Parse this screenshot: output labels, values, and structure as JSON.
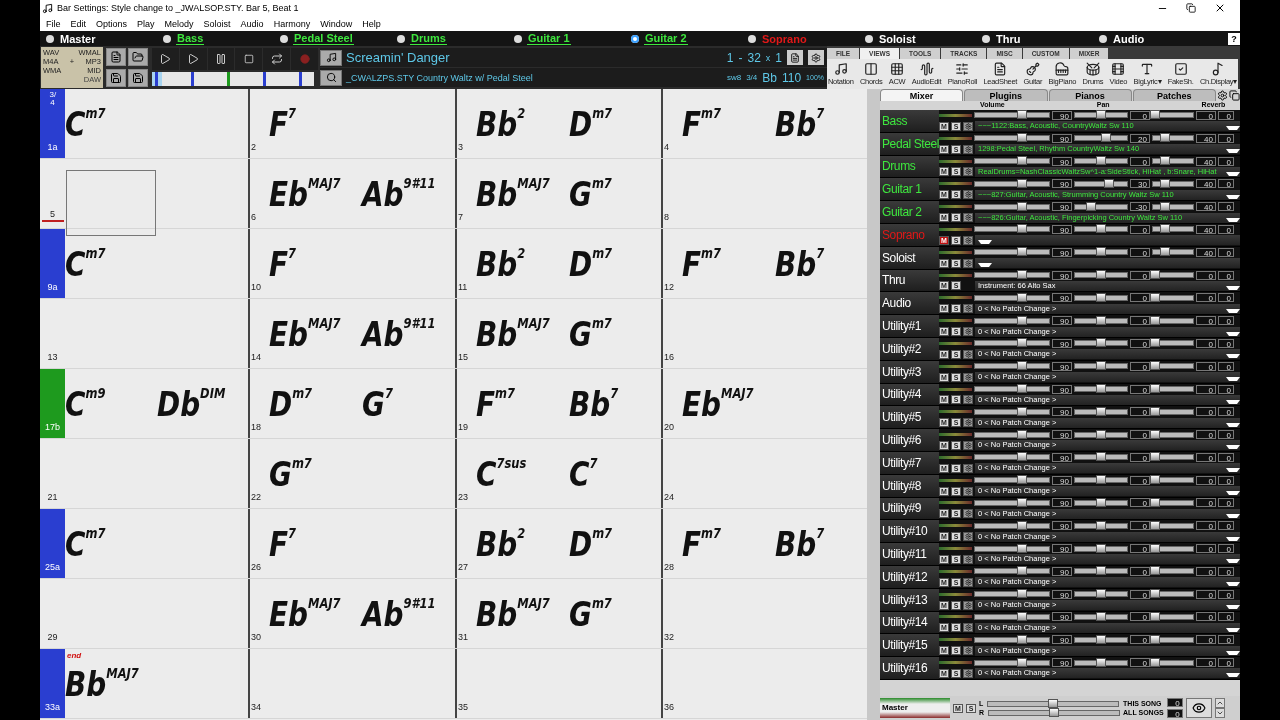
{
  "window": {
    "title": "Bar Settings: Style change to _JWALSOP.STY.  Bar 5, Beat 1"
  },
  "menu": [
    "File",
    "Edit",
    "Options",
    "Play",
    "Melody",
    "Soloist",
    "Audio",
    "Harmony",
    "Window",
    "Help"
  ],
  "tracks": [
    {
      "name": "Master",
      "color": "#ffffff",
      "underlined": false,
      "selected": false
    },
    {
      "name": "Bass",
      "color": "#3ee83e",
      "underlined": true,
      "selected": false
    },
    {
      "name": "Pedal Steel",
      "color": "#3ee83e",
      "underlined": true,
      "selected": false
    },
    {
      "name": "Drums",
      "color": "#3ee83e",
      "underlined": true,
      "selected": false
    },
    {
      "name": "Guitar 1",
      "color": "#3ee83e",
      "underlined": true,
      "selected": false
    },
    {
      "name": "Guitar 2",
      "color": "#3ee83e",
      "underlined": true,
      "selected": true
    },
    {
      "name": "Soprano",
      "color": "#e01818",
      "underlined": false,
      "selected": false
    },
    {
      "name": "Soloist",
      "color": "#ffffff",
      "underlined": false,
      "selected": false
    },
    {
      "name": "Thru",
      "color": "#ffffff",
      "underlined": false,
      "selected": false
    },
    {
      "name": "Audio",
      "color": "#ffffff",
      "underlined": false,
      "selected": false
    }
  ],
  "help_button": "?",
  "file_formats": [
    "WAV",
    "WMAL",
    "M4A",
    "+",
    "MP3",
    "WMA",
    "MID"
  ],
  "daw_label": "DAW",
  "song": {
    "title": "Screamin' Danger",
    "style": "_CWALZPS.STY Country Waltz w/ Pedal Steel"
  },
  "counter": {
    "start": "1",
    "dash": "-",
    "end": "32",
    "times_sign": "x",
    "repeats": "1"
  },
  "song_settings": {
    "feel": "sw8",
    "time_signature": "3/4",
    "key": "Bb",
    "tempo": "110",
    "tempo_percent": "100%"
  },
  "ribbon_tabs": [
    {
      "label": "FILE",
      "selected": false
    },
    {
      "label": "VIEWS",
      "selected": true
    },
    {
      "label": "TOOLS",
      "selected": false
    },
    {
      "label": "TRACKS",
      "selected": false
    },
    {
      "label": "MISC",
      "selected": false
    },
    {
      "label": "CUSTOM",
      "selected": false
    },
    {
      "label": "MIXER",
      "selected": false
    }
  ],
  "ribbon_buttons": [
    "Notation",
    "Chords",
    "ACW",
    "AudioEdit",
    "PianoRoll",
    "LeadSheet",
    "Guitar",
    "BigPiano",
    "Drums",
    "Video",
    "BigLyric▾",
    "FakeSh.",
    "Ch.Display▾"
  ],
  "progress": {
    "level": 0.06
  },
  "chord_rows": [
    {
      "marker": {
        "label": "1a",
        "color": "#2a3ed0"
      },
      "time_signature": "3/4",
      "bars": [
        {
          "chords": [
            {
              "root": "C",
              "ext": "m7"
            }
          ]
        },
        {
          "number": "2",
          "chords": [
            {
              "root": "F",
              "ext": "7"
            }
          ]
        },
        {
          "number": "3",
          "chords": [
            {
              "root": "Bb",
              "ext": "2"
            },
            {
              "root": "D",
              "ext": "m7"
            }
          ]
        },
        {
          "number": "4",
          "chords": [
            {
              "root": "F",
              "ext": "m7"
            },
            {
              "root": "Bb",
              "ext": "7"
            }
          ]
        }
      ]
    },
    {
      "bars": [
        {
          "number": "5",
          "selected": true
        },
        {
          "number": "6",
          "chords": [
            {
              "root": "Eb",
              "ext": "MAJ7"
            },
            {
              "root": "Ab",
              "ext": "9#11"
            }
          ]
        },
        {
          "number": "7",
          "chords": [
            {
              "root": "Bb",
              "ext": "MAJ7"
            },
            {
              "root": "G",
              "ext": "m7"
            }
          ]
        },
        {
          "number": "8"
        }
      ]
    },
    {
      "marker": {
        "label": "9a",
        "color": "#2a3ed0"
      },
      "bars": [
        {
          "chords": [
            {
              "root": "C",
              "ext": "m7"
            }
          ]
        },
        {
          "number": "10",
          "chords": [
            {
              "root": "F",
              "ext": "7"
            }
          ]
        },
        {
          "number": "11",
          "chords": [
            {
              "root": "Bb",
              "ext": "2"
            },
            {
              "root": "D",
              "ext": "m7"
            }
          ]
        },
        {
          "number": "12",
          "chords": [
            {
              "root": "F",
              "ext": "m7"
            },
            {
              "root": "Bb",
              "ext": "7"
            }
          ]
        }
      ]
    },
    {
      "bars": [
        {
          "number": "13"
        },
        {
          "number": "14",
          "chords": [
            {
              "root": "Eb",
              "ext": "MAJ7"
            },
            {
              "root": "Ab",
              "ext": "9#11"
            }
          ]
        },
        {
          "number": "15",
          "chords": [
            {
              "root": "Bb",
              "ext": "MAJ7"
            },
            {
              "root": "G",
              "ext": "m7"
            }
          ]
        },
        {
          "number": "16"
        }
      ]
    },
    {
      "marker": {
        "label": "17b",
        "color": "#1e9a1e"
      },
      "bars": [
        {
          "chords": [
            {
              "root": "C",
              "ext": "m9"
            },
            {
              "root": "Db",
              "ext": "DIM"
            }
          ]
        },
        {
          "number": "18",
          "chords": [
            {
              "root": "D",
              "ext": "m7"
            },
            {
              "root": "G",
              "ext": "7"
            }
          ]
        },
        {
          "number": "19",
          "chords": [
            {
              "root": "F",
              "ext": "m7"
            },
            {
              "root": "Bb",
              "ext": "7"
            }
          ]
        },
        {
          "number": "20",
          "chords": [
            {
              "root": "Eb",
              "ext": "MAJ7"
            }
          ]
        }
      ]
    },
    {
      "bars": [
        {
          "number": "21"
        },
        {
          "number": "22",
          "chords": [
            {
              "root": "G",
              "ext": "m7"
            }
          ]
        },
        {
          "number": "23",
          "chords": [
            {
              "root": "C",
              "ext": "7sus"
            },
            {
              "root": "C",
              "ext": "7"
            }
          ]
        },
        {
          "number": "24"
        }
      ]
    },
    {
      "marker": {
        "label": "25a",
        "color": "#2a3ed0"
      },
      "bars": [
        {
          "chords": [
            {
              "root": "C",
              "ext": "m7"
            }
          ]
        },
        {
          "number": "26",
          "chords": [
            {
              "root": "F",
              "ext": "7"
            }
          ]
        },
        {
          "number": "27",
          "chords": [
            {
              "root": "Bb",
              "ext": "2"
            },
            {
              "root": "D",
              "ext": "m7"
            }
          ]
        },
        {
          "number": "28",
          "chords": [
            {
              "root": "F",
              "ext": "m7"
            },
            {
              "root": "Bb",
              "ext": "7"
            }
          ]
        }
      ]
    },
    {
      "bars": [
        {
          "number": "29"
        },
        {
          "number": "30",
          "chords": [
            {
              "root": "Eb",
              "ext": "MAJ7"
            },
            {
              "root": "Ab",
              "ext": "9#11"
            }
          ]
        },
        {
          "number": "31",
          "chords": [
            {
              "root": "Bb",
              "ext": "MAJ7"
            },
            {
              "root": "G",
              "ext": "m7"
            }
          ]
        },
        {
          "number": "32"
        }
      ]
    },
    {
      "marker": {
        "label": "33a",
        "color": "#2a3ed0"
      },
      "bars": [
        {
          "end_mark": "end",
          "chords": [
            {
              "root": "Bb",
              "ext": "MAJ7"
            }
          ]
        },
        {
          "number": "34"
        },
        {
          "number": "35"
        },
        {
          "number": "36"
        }
      ]
    }
  ],
  "mixer": {
    "tabs": [
      {
        "label": "Mixer",
        "selected": true
      },
      {
        "label": "Plugins",
        "selected": false
      },
      {
        "label": "Pianos",
        "selected": false
      },
      {
        "label": "Patches",
        "selected": false
      }
    ],
    "headers": [
      "Volume",
      "Pan",
      "Reverb"
    ],
    "channels": [
      {
        "name": "Bass",
        "color": "#3ee83e",
        "mute_label": "M",
        "solo_label": "S",
        "muted": false,
        "fx": true,
        "volume": {
          "reading": "90",
          "level": 0.63
        },
        "pan": {
          "reading": "0",
          "level": 0.5
        },
        "reverb": {
          "reading": "0",
          "level": 0.05
        },
        "column_4": "0",
        "patch": "~~~1122:Bass, Acoustic, CountryWaltz Sw 110"
      },
      {
        "name": "Pedal Steel",
        "color": "#3ee83e",
        "mute_label": "M",
        "solo_label": "S",
        "muted": false,
        "fx": true,
        "volume": {
          "reading": "90",
          "level": 0.63
        },
        "pan": {
          "reading": "20",
          "level": 0.6
        },
        "reverb": {
          "reading": "40",
          "level": 0.3
        },
        "column_4": "0",
        "patch": "1298:Pedal Steel, Rhythm CountryWaltz Sw 140"
      },
      {
        "name": "Drums",
        "color": "#3ee83e",
        "mute_label": "M",
        "solo_label": "S",
        "muted": false,
        "fx": true,
        "volume": {
          "reading": "90",
          "level": 0.63
        },
        "pan": {
          "reading": "0",
          "level": 0.5
        },
        "reverb": {
          "reading": "40",
          "level": 0.3
        },
        "column_4": "0",
        "patch": "RealDrums=NashClassicWaltzSw^1-a:SideStick, HiHat , b:Snare, HiHat"
      },
      {
        "name": "Guitar 1",
        "color": "#3ee83e",
        "mute_label": "M",
        "solo_label": "S",
        "muted": false,
        "fx": true,
        "volume": {
          "reading": "90",
          "level": 0.63
        },
        "pan": {
          "reading": "30",
          "level": 0.66
        },
        "reverb": {
          "reading": "40",
          "level": 0.3
        },
        "column_4": "0",
        "patch": "~~~827:Guitar, Acoustic, Strumming Country Waltz Sw 110"
      },
      {
        "name": "Guitar 2",
        "color": "#3ee83e",
        "mute_label": "M",
        "solo_label": "S",
        "muted": false,
        "fx": true,
        "volume": {
          "reading": "90",
          "level": 0.63
        },
        "pan": {
          "reading": "-30",
          "level": 0.3
        },
        "reverb": {
          "reading": "40",
          "level": 0.3
        },
        "column_4": "0",
        "patch": "~~~826:Guitar, Acoustic, Fingerpicking Country Waltz Sw 110"
      },
      {
        "name": "Soprano",
        "color": "#e01818",
        "mute_label": "M",
        "solo_label": "S",
        "muted": true,
        "fx": true,
        "volume": {
          "reading": "90",
          "level": 0.63
        },
        "pan": {
          "reading": "0",
          "level": 0.5
        },
        "reverb": {
          "reading": "40",
          "level": 0.3
        },
        "column_4": "0"
      },
      {
        "name": "Soloist",
        "color": "#ffffff",
        "mute_label": "M",
        "solo_label": "S",
        "muted": false,
        "fx": true,
        "volume": {
          "reading": "90",
          "level": 0.63
        },
        "pan": {
          "reading": "0",
          "level": 0.5
        },
        "reverb": {
          "reading": "40",
          "level": 0.3
        },
        "column_4": "0"
      },
      {
        "name": "Thru",
        "color": "#ffffff",
        "mute_label": "M",
        "solo_label": "S",
        "muted": false,
        "fx": false,
        "volume": {
          "reading": "90",
          "level": 0.63
        },
        "pan": {
          "reading": "0",
          "level": 0.5
        },
        "reverb": {
          "reading": "0",
          "level": 0.05
        },
        "column_4": "0",
        "patch": "Instrument: 66 Alto Sax"
      },
      {
        "name": "Audio",
        "color": "#ffffff",
        "mute_label": "M",
        "solo_label": "S",
        "muted": false,
        "fx": true,
        "volume": {
          "reading": "90",
          "level": 0.63
        },
        "pan": {
          "reading": "0",
          "level": 0.5
        },
        "reverb": {
          "reading": "0",
          "level": 0.05
        },
        "column_4": "0",
        "patch": "0 < No Patch Change >"
      },
      {
        "name": "Utility#1",
        "color": "#ffffff",
        "mute_label": "M",
        "solo_label": "S",
        "muted": false,
        "fx": true,
        "volume": {
          "reading": "90",
          "level": 0.63
        },
        "pan": {
          "reading": "0",
          "level": 0.5
        },
        "reverb": {
          "reading": "0",
          "level": 0.05
        },
        "column_4": "0",
        "patch": "0 < No Patch Change >"
      },
      {
        "name": "Utility#2",
        "color": "#ffffff",
        "mute_label": "M",
        "solo_label": "S",
        "muted": false,
        "fx": true,
        "volume": {
          "reading": "90",
          "level": 0.63
        },
        "pan": {
          "reading": "0",
          "level": 0.5
        },
        "reverb": {
          "reading": "0",
          "level": 0.05
        },
        "column_4": "0",
        "patch": "0 < No Patch Change >"
      },
      {
        "name": "Utility#3",
        "color": "#ffffff",
        "mute_label": "M",
        "solo_label": "S",
        "muted": false,
        "fx": true,
        "volume": {
          "reading": "90",
          "level": 0.63
        },
        "pan": {
          "reading": "0",
          "level": 0.5
        },
        "reverb": {
          "reading": "0",
          "level": 0.05
        },
        "column_4": "0",
        "patch": "0 < No Patch Change >"
      },
      {
        "name": "Utility#4",
        "color": "#ffffff",
        "mute_label": "M",
        "solo_label": "S",
        "muted": false,
        "fx": true,
        "volume": {
          "reading": "90",
          "level": 0.63
        },
        "pan": {
          "reading": "0",
          "level": 0.5
        },
        "reverb": {
          "reading": "0",
          "level": 0.05
        },
        "column_4": "0",
        "patch": "0 < No Patch Change >"
      },
      {
        "name": "Utility#5",
        "color": "#ffffff",
        "mute_label": "M",
        "solo_label": "S",
        "muted": false,
        "fx": true,
        "volume": {
          "reading": "90",
          "level": 0.63
        },
        "pan": {
          "reading": "0",
          "level": 0.5
        },
        "reverb": {
          "reading": "0",
          "level": 0.05
        },
        "column_4": "0",
        "patch": "0 < No Patch Change >"
      },
      {
        "name": "Utility#6",
        "color": "#ffffff",
        "mute_label": "M",
        "solo_label": "S",
        "muted": false,
        "fx": true,
        "volume": {
          "reading": "90",
          "level": 0.63
        },
        "pan": {
          "reading": "0",
          "level": 0.5
        },
        "reverb": {
          "reading": "0",
          "level": 0.05
        },
        "column_4": "0",
        "patch": "0 < No Patch Change >"
      },
      {
        "name": "Utility#7",
        "color": "#ffffff",
        "mute_label": "M",
        "solo_label": "S",
        "muted": false,
        "fx": true,
        "volume": {
          "reading": "90",
          "level": 0.63
        },
        "pan": {
          "reading": "0",
          "level": 0.5
        },
        "reverb": {
          "reading": "0",
          "level": 0.05
        },
        "column_4": "0",
        "patch": "0 < No Patch Change >"
      },
      {
        "name": "Utility#8",
        "color": "#ffffff",
        "mute_label": "M",
        "solo_label": "S",
        "muted": false,
        "fx": true,
        "volume": {
          "reading": "90",
          "level": 0.63
        },
        "pan": {
          "reading": "0",
          "level": 0.5
        },
        "reverb": {
          "reading": "0",
          "level": 0.05
        },
        "column_4": "0",
        "patch": "0 < No Patch Change >"
      },
      {
        "name": "Utility#9",
        "color": "#ffffff",
        "mute_label": "M",
        "solo_label": "S",
        "muted": false,
        "fx": true,
        "volume": {
          "reading": "90",
          "level": 0.63
        },
        "pan": {
          "reading": "0",
          "level": 0.5
        },
        "reverb": {
          "reading": "0",
          "level": 0.05
        },
        "column_4": "0",
        "patch": "0 < No Patch Change >"
      },
      {
        "name": "Utility#10",
        "color": "#ffffff",
        "mute_label": "M",
        "solo_label": "S",
        "muted": false,
        "fx": true,
        "volume": {
          "reading": "90",
          "level": 0.63
        },
        "pan": {
          "reading": "0",
          "level": 0.5
        },
        "reverb": {
          "reading": "0",
          "level": 0.05
        },
        "column_4": "0",
        "patch": "0 < No Patch Change >"
      },
      {
        "name": "Utility#11",
        "color": "#ffffff",
        "mute_label": "M",
        "solo_label": "S",
        "muted": false,
        "fx": true,
        "volume": {
          "reading": "90",
          "level": 0.63
        },
        "pan": {
          "reading": "0",
          "level": 0.5
        },
        "reverb": {
          "reading": "0",
          "level": 0.05
        },
        "column_4": "0",
        "patch": "0 < No Patch Change >"
      },
      {
        "name": "Utility#12",
        "color": "#ffffff",
        "mute_label": "M",
        "solo_label": "S",
        "muted": false,
        "fx": true,
        "volume": {
          "reading": "90",
          "level": 0.63
        },
        "pan": {
          "reading": "0",
          "level": 0.5
        },
        "reverb": {
          "reading": "0",
          "level": 0.05
        },
        "column_4": "0",
        "patch": "0 < No Patch Change >"
      },
      {
        "name": "Utility#13",
        "color": "#ffffff",
        "mute_label": "M",
        "solo_label": "S",
        "muted": false,
        "fx": true,
        "volume": {
          "reading": "90",
          "level": 0.63
        },
        "pan": {
          "reading": "0",
          "level": 0.5
        },
        "reverb": {
          "reading": "0",
          "level": 0.05
        },
        "column_4": "0",
        "patch": "0 < No Patch Change >"
      },
      {
        "name": "Utility#14",
        "color": "#ffffff",
        "mute_label": "M",
        "solo_label": "S",
        "muted": false,
        "fx": true,
        "volume": {
          "reading": "90",
          "level": 0.63
        },
        "pan": {
          "reading": "0",
          "level": 0.5
        },
        "reverb": {
          "reading": "0",
          "level": 0.05
        },
        "column_4": "0",
        "patch": "0 < No Patch Change >"
      },
      {
        "name": "Utility#15",
        "color": "#ffffff",
        "mute_label": "M",
        "solo_label": "S",
        "muted": false,
        "fx": true,
        "volume": {
          "reading": "90",
          "level": 0.63
        },
        "pan": {
          "reading": "0",
          "level": 0.5
        },
        "reverb": {
          "reading": "0",
          "level": 0.05
        },
        "column_4": "0",
        "patch": "0 < No Patch Change >"
      },
      {
        "name": "Utility#16",
        "color": "#ffffff",
        "mute_label": "M",
        "solo_label": "S",
        "muted": false,
        "fx": true,
        "volume": {
          "reading": "90",
          "level": 0.63
        },
        "pan": {
          "reading": "0",
          "level": 0.5
        },
        "reverb": {
          "reading": "0",
          "level": 0.05
        },
        "column_4": "0",
        "patch": "0 < No Patch Change >"
      }
    ],
    "master": {
      "name": "Master",
      "mute_label": "M",
      "solo_label": "S",
      "left_label": "L",
      "right_label": "R",
      "left": {
        "level": 0.5
      },
      "right": {
        "level": 0.5
      },
      "this_song_label": "THIS SONG",
      "this_song_value": "0",
      "all_songs_label": "ALL SONGS",
      "all_songs_value": "0"
    }
  }
}
